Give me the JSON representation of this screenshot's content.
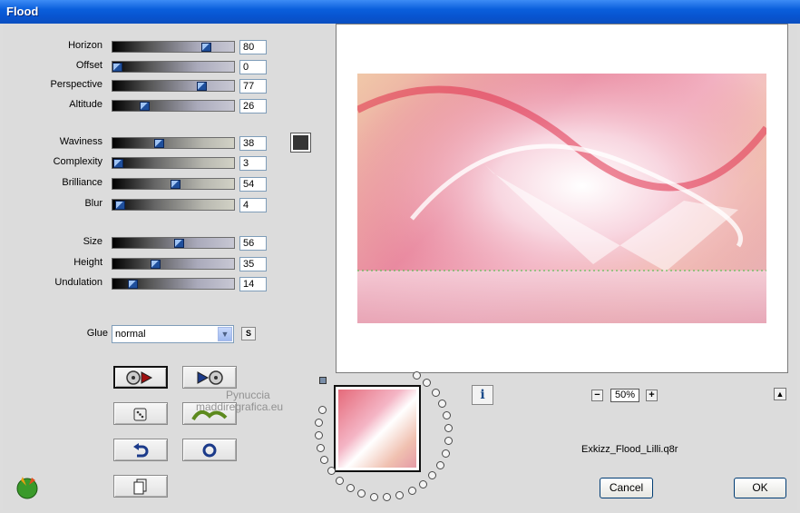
{
  "window": {
    "title": "Flood"
  },
  "params_group1": [
    {
      "label": "Horizon",
      "value": "80",
      "pos": 0.8
    },
    {
      "label": "Offset",
      "value": "0",
      "pos": 0.0
    },
    {
      "label": "Perspective",
      "value": "77",
      "pos": 0.77
    },
    {
      "label": "Altitude",
      "value": "26",
      "pos": 0.26
    }
  ],
  "params_group2": [
    {
      "label": "Waviness",
      "value": "38",
      "pos": 0.38
    },
    {
      "label": "Complexity",
      "value": "3",
      "pos": 0.03
    },
    {
      "label": "Brilliance",
      "value": "54",
      "pos": 0.54
    },
    {
      "label": "Blur",
      "value": "4",
      "pos": 0.04
    }
  ],
  "params_group3": [
    {
      "label": "Size",
      "value": "56",
      "pos": 0.56
    },
    {
      "label": "Height",
      "value": "35",
      "pos": 0.35
    },
    {
      "label": "Undulation",
      "value": "14",
      "pos": 0.14
    }
  ],
  "colors": {
    "swatch": "#353535",
    "accent": "#0a5fdc"
  },
  "glue": {
    "label": "Glue",
    "value": "normal",
    "s_button": "S"
  },
  "zoom": {
    "value": "50%",
    "minus": "−",
    "plus": "+"
  },
  "preset_name": "Exkizz_Flood_Lilli.q8r",
  "buttons": {
    "cancel": "Cancel",
    "ok": "OK"
  },
  "watermark": {
    "line1": "Pynuccia",
    "line2": "maddiregrafica.eu"
  },
  "icons": {
    "play_prev": "record-play-icon",
    "play_next": "play-record-icon",
    "random": "dice-icon",
    "grass": "grass-icon",
    "undo": "undo-arrow-icon",
    "reset": "reset-circle-icon",
    "paste": "document-icon",
    "info": "info-icon",
    "collapse": "collapse-up-icon",
    "logo": "app-logo-icon"
  }
}
